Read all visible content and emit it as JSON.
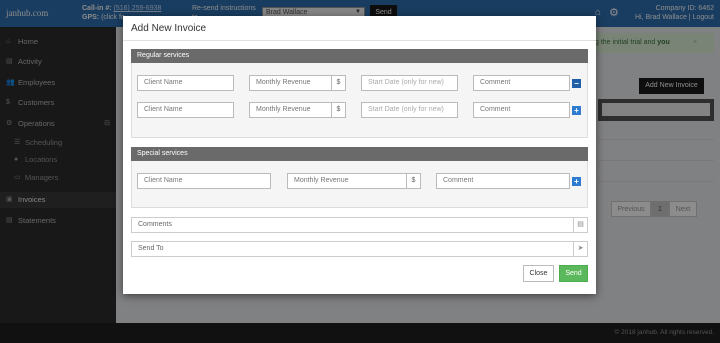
{
  "header": {
    "brand": "janhub.com",
    "callin_label": "Call-in #:",
    "callin_number": "(516) 259-6938",
    "gps_label": "GPS:",
    "gps_link": "(click fo",
    "resend_line1": "Re-send instructions",
    "resend_line2": "to",
    "selected_user": "Brad Wallace",
    "send_label": "Send",
    "company_id": "Company ID: 6462",
    "greeting": "Hi, Brad Wallace",
    "separator": "|",
    "logout": "Logout",
    "home_icon": "home-icon",
    "gear_icon": "gear-icon"
  },
  "sidebar": {
    "items": [
      {
        "label": "Home",
        "icon": "⌂"
      },
      {
        "label": "Activity",
        "icon": "▤"
      },
      {
        "label": "Employees",
        "icon": "👥"
      },
      {
        "label": "Customers",
        "icon": "$"
      },
      {
        "label": "Operations",
        "icon": "⚙",
        "toggle": "⊟"
      },
      {
        "label": "Scheduling",
        "icon": "☰"
      },
      {
        "label": "Locations",
        "icon": "●"
      },
      {
        "label": "Managers",
        "icon": "▭"
      },
      {
        "label": "Invoices",
        "icon": "▣"
      },
      {
        "label": "Statements",
        "icon": "▤"
      }
    ]
  },
  "background": {
    "alert_text": "g the initial trial and",
    "alert_bold": "you",
    "alert_close": "×",
    "add_invoice": "Add New Invoice",
    "pager": {
      "previous": "Previous",
      "current": "1",
      "next": "Next"
    },
    "footer": "© 2018 janhub. All rights reserved."
  },
  "modal": {
    "title": "Add New Invoice",
    "regular": {
      "heading": "Regular services",
      "rows": [
        {
          "client": "Client Name",
          "revenue": "Monthly Revenue",
          "currency": "$",
          "start": "Start Date (only for new)",
          "comment": "Comment",
          "action": "−"
        },
        {
          "client": "Client Name",
          "revenue": "Monthly Revenue",
          "currency": "$",
          "start": "Start Date (only for new)",
          "comment": "Comment",
          "action": "+"
        }
      ]
    },
    "special": {
      "heading": "Special services",
      "client": "Client Name",
      "revenue": "Monthly Revenue",
      "currency": "$",
      "comment": "Comment",
      "action": "+"
    },
    "comments_placeholder": "Comments",
    "send_to_placeholder": "Send To",
    "close_label": "Close",
    "send_label": "Send"
  }
}
